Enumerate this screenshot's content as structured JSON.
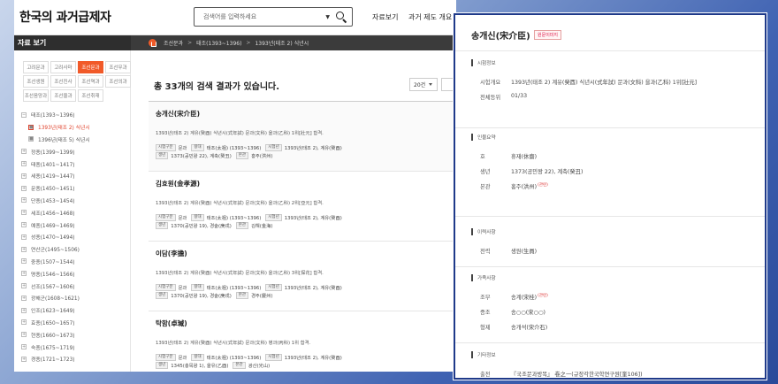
{
  "site": {
    "logo": "한국의 과거급제자",
    "search_placeholder": "검색어를 입력하세요",
    "nav": [
      "자료보기",
      "과거 제도 개요"
    ]
  },
  "navbar": {
    "section_title": "자료 보기",
    "breadcrumb": [
      "조선문과",
      "태조(1393~1396)",
      "1393년(태조 2) 식년시"
    ]
  },
  "sidebar": {
    "era_tabs": [
      "고려문과",
      "고려사마",
      "조선문과",
      "조선무과",
      "조선생원",
      "조선진사",
      "조선역과",
      "조선의과",
      "조선음양과",
      "조선율과",
      "조선취재"
    ],
    "active_tab": "조선문과",
    "tree": [
      {
        "label": "태조(1393~1396)",
        "box": "−",
        "level": 0,
        "hl": false
      },
      {
        "label": "1393년(태조 2) 식년시",
        "box": "■",
        "level": 1,
        "hl": true
      },
      {
        "label": "1396년(태조 5) 식년시",
        "box": "■",
        "level": 1,
        "hl": false
      },
      {
        "label": "정종(1399~1399)",
        "box": "+",
        "level": 0,
        "hl": false
      },
      {
        "label": "태종(1401~1417)",
        "box": "+",
        "level": 0,
        "hl": false
      },
      {
        "label": "세종(1419~1447)",
        "box": "+",
        "level": 0,
        "hl": false
      },
      {
        "label": "문종(1450~1451)",
        "box": "+",
        "level": 0,
        "hl": false
      },
      {
        "label": "단종(1453~1454)",
        "box": "+",
        "level": 0,
        "hl": false
      },
      {
        "label": "세조(1456~1468)",
        "box": "+",
        "level": 0,
        "hl": false
      },
      {
        "label": "예종(1469~1469)",
        "box": "+",
        "level": 0,
        "hl": false
      },
      {
        "label": "성종(1470~1494)",
        "box": "+",
        "level": 0,
        "hl": false
      },
      {
        "label": "연산군(1495~1506)",
        "box": "+",
        "level": 0,
        "hl": false
      },
      {
        "label": "중종(1507~1544)",
        "box": "+",
        "level": 0,
        "hl": false
      },
      {
        "label": "명종(1546~1566)",
        "box": "+",
        "level": 0,
        "hl": false
      },
      {
        "label": "선조(1567~1606)",
        "box": "+",
        "level": 0,
        "hl": false
      },
      {
        "label": "광해군(1608~1621)",
        "box": "+",
        "level": 0,
        "hl": false
      },
      {
        "label": "인조(1623~1649)",
        "box": "+",
        "level": 0,
        "hl": false
      },
      {
        "label": "효종(1650~1657)",
        "box": "+",
        "level": 0,
        "hl": false
      },
      {
        "label": "현종(1660~1673)",
        "box": "+",
        "level": 0,
        "hl": false
      },
      {
        "label": "숙종(1675~1719)",
        "box": "+",
        "level": 0,
        "hl": false
      },
      {
        "label": "경종(1721~1723)",
        "box": "+",
        "level": 0,
        "hl": false
      }
    ]
  },
  "results": {
    "count_text": "총 33개의 검색 결과가 있습니다.",
    "page_size": "20건",
    "items": [
      {
        "name": "송개신(宋介臣)",
        "desc": "1393년(태조 2) 계유(癸酉) 식년시(式年試) 문과(文科) 을과(乙科) 1위[壯元] 합격.",
        "row1": [
          [
            "시험구분",
            "문과"
          ],
          [
            "왕대",
            "태조(太祖) (1393~1396)"
          ],
          [
            "시험년",
            "1393년(태조 2), 계유(癸酉)"
          ]
        ],
        "row2": [
          [
            "생년",
            "1373(공민왕 22), 계축(癸丑)"
          ],
          [
            "본관",
            "홍주(洪州)"
          ]
        ]
      },
      {
        "name": "김효원(金孝源)",
        "desc": "1393년(태조 2) 계유(癸酉) 식년시(式年試) 문과(文科) 을과(乙科) 2위[亞元] 합격.",
        "row1": [
          [
            "시험구분",
            "문과"
          ],
          [
            "왕대",
            "태조(太祖) (1393~1396)"
          ],
          [
            "시험년",
            "1393년(태조 2), 계유(癸酉)"
          ]
        ],
        "row2": [
          [
            "생년",
            "1370(공민왕 19), 경술(庚戌)"
          ],
          [
            "본관",
            "김해(金海)"
          ]
        ]
      },
      {
        "name": "이담(李擔)",
        "desc": "1393년(태조 2) 계유(癸酉) 식년시(式年試) 문과(文科) 을과(乙科) 3위[探花] 합격.",
        "row1": [
          [
            "시험구분",
            "문과"
          ],
          [
            "왕대",
            "태조(太祖) (1393~1396)"
          ],
          [
            "시험년",
            "1393년(태조 2), 계유(癸酉)"
          ]
        ],
        "row2": [
          [
            "생년",
            "1370(공민왕 19), 경술(庚戌)"
          ],
          [
            "본관",
            "경주(慶州)"
          ]
        ]
      },
      {
        "name": "탁함(卓瑊)",
        "desc": "1393년(태조 2) 계유(癸酉) 식년시(式年試) 문과(文科) 병과(丙科) 1위 합격.",
        "row1": [
          [
            "시험구분",
            "문과"
          ],
          [
            "왕대",
            "태조(太祖) (1393~1396)"
          ],
          [
            "시험년",
            "1393년(태조 2), 계유(癸酉)"
          ]
        ],
        "row2": [
          [
            "생년",
            "1345(충목왕 1), 을유(乙酉)"
          ],
          [
            "본관",
            "광산(光山)"
          ]
        ]
      }
    ]
  },
  "detail": {
    "name": "송개신(宋介臣)",
    "badge": "원문이미지",
    "sections": [
      {
        "title": "시험정보",
        "rows": [
          [
            "시험개요",
            "1393년(태조 2) 계유(癸酉) 식년시(式年試) 문과(文科) 을과(乙科) 1위[壯元]",
            ""
          ],
          [
            "전체등위",
            "01/33",
            ""
          ]
        ]
      },
      {
        "title": "인물요약",
        "rows": [
          [
            "호",
            "휴재(休齋)",
            ""
          ],
          [
            "생년",
            "1373(공민왕 22), 계축(癸丑)",
            ""
          ],
          [
            "본관",
            "홍주(洪州)",
            "(관련)"
          ]
        ]
      },
      {
        "title": "이력사항",
        "rows": [
          [
            "전력",
            "생원(生員)",
            ""
          ]
        ]
      },
      {
        "title": "가족사항",
        "rows": [
          [
            "조부",
            "송계(宋桂)",
            "(관련)"
          ],
          [
            "증조",
            "송○○(宋○○)",
            ""
          ],
          [
            "형제",
            "송개석(宋介石)",
            ""
          ]
        ]
      },
      {
        "title": "기타정보",
        "rows": [
          [
            "출전",
            "『국조문과방목』 卷之一(규장각한국학연구원[奎106])",
            ""
          ]
        ]
      }
    ]
  }
}
